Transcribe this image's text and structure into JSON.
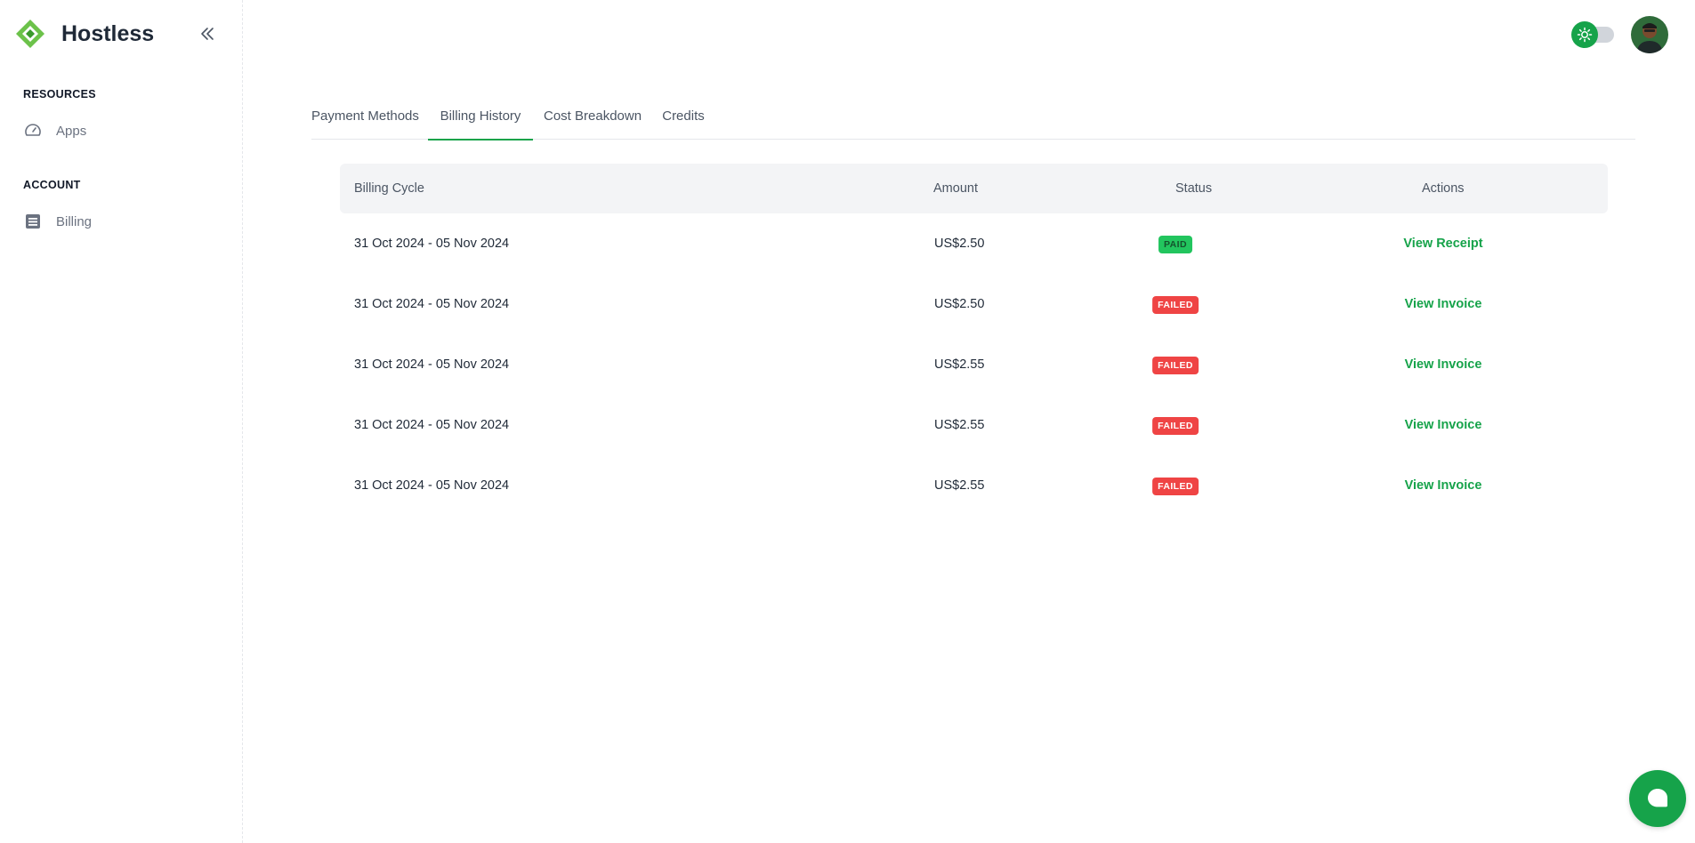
{
  "brand": {
    "name": "Hostless",
    "accent": "#16a34a"
  },
  "sidebar": {
    "sections": [
      {
        "label": "RESOURCES",
        "items": [
          {
            "label": "Apps",
            "icon": "gauge-icon"
          }
        ]
      },
      {
        "label": "ACCOUNT",
        "items": [
          {
            "label": "Billing",
            "icon": "document-icon"
          }
        ]
      }
    ]
  },
  "tabs": [
    {
      "label": "Payment Methods",
      "active": false
    },
    {
      "label": "Billing History",
      "active": true
    },
    {
      "label": "Cost Breakdown",
      "active": false
    },
    {
      "label": "Credits",
      "active": false
    }
  ],
  "table": {
    "columns": [
      "Billing Cycle",
      "Amount",
      "Status",
      "Actions"
    ],
    "rows": [
      {
        "cycle": "31 Oct 2024 - 05 Nov 2024",
        "amount": "US$2.50",
        "status": "PAID",
        "action": "View Receipt"
      },
      {
        "cycle": "31 Oct 2024 - 05 Nov 2024",
        "amount": "US$2.50",
        "status": "FAILED",
        "action": "View Invoice"
      },
      {
        "cycle": "31 Oct 2024 - 05 Nov 2024",
        "amount": "US$2.55",
        "status": "FAILED",
        "action": "View Invoice"
      },
      {
        "cycle": "31 Oct 2024 - 05 Nov 2024",
        "amount": "US$2.55",
        "status": "FAILED",
        "action": "View Invoice"
      },
      {
        "cycle": "31 Oct 2024 - 05 Nov 2024",
        "amount": "US$2.55",
        "status": "FAILED",
        "action": "View Invoice"
      }
    ]
  },
  "status_colors": {
    "paid": "#22c55e",
    "failed": "#ef4444"
  }
}
